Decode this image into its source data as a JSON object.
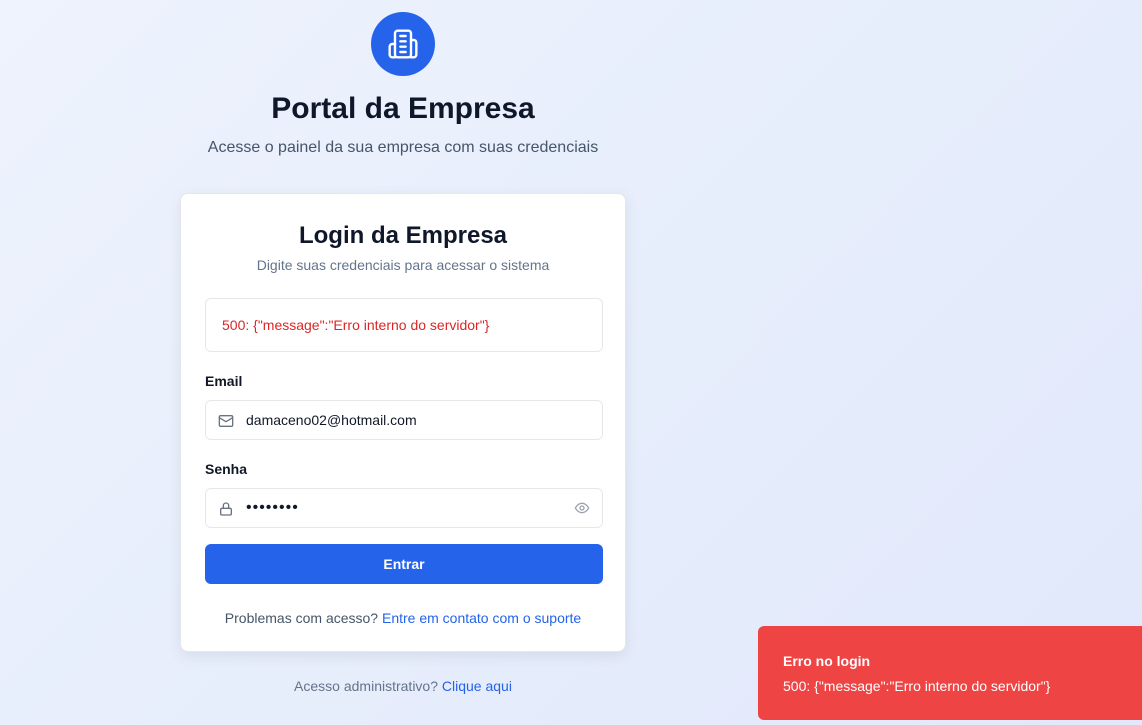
{
  "header": {
    "logo_icon": "building-icon",
    "title": "Portal da Empresa",
    "subtitle": "Acesse o painel da sua empresa com suas credenciais"
  },
  "card": {
    "title": "Login da Empresa",
    "subtitle": "Digite suas credenciais para acessar o sistema",
    "error_message": "500: {\"message\":\"Erro interno do servidor\"}",
    "email": {
      "label": "Email",
      "icon": "mail-icon",
      "value": "damaceno02@hotmail.com"
    },
    "password": {
      "label": "Senha",
      "icon": "lock-icon",
      "masked_value": "••••••••",
      "toggle_icon": "eye-icon"
    },
    "submit_label": "Entrar",
    "help_text": "Problemas com acesso?",
    "help_link": "Entre em contato com o suporte"
  },
  "footer": {
    "admin_text": "Acesso administrativo?",
    "admin_link": "Clique aqui"
  },
  "toast": {
    "title": "Erro no login",
    "message": "500: {\"message\":\"Erro interno do servidor\"}"
  },
  "colors": {
    "primary": "#2563eb",
    "error_text": "#dc2626",
    "toast_background": "#ef4444"
  }
}
